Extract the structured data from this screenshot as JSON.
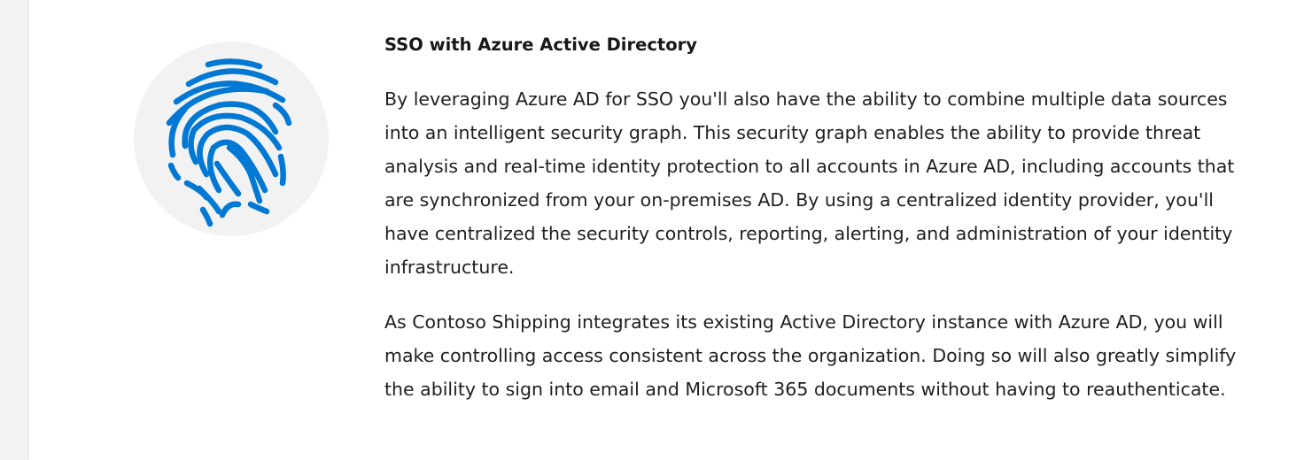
{
  "section": {
    "title": "SSO with Azure Active Directory",
    "illustration_icon": "fingerprint-icon",
    "accent_color": "#0078d4",
    "paragraphs": [
      "By leveraging Azure AD for SSO you'll also have the ability to combine multiple data sources into an intelligent security graph. This security graph enables the ability to provide threat analysis and real-time identity protection to all accounts in Azure AD, including accounts that are synchronized from your on-premises AD. By using a centralized identity provider, you'll have centralized the security controls, reporting, alerting, and administration of your identity infrastructure.",
      "As Contoso Shipping integrates its existing Active Directory instance with Azure AD, you will make controlling access consistent across the organization. Doing so will also greatly simplify the ability to sign into email and Microsoft 365 documents without having to reauthenticate."
    ]
  }
}
